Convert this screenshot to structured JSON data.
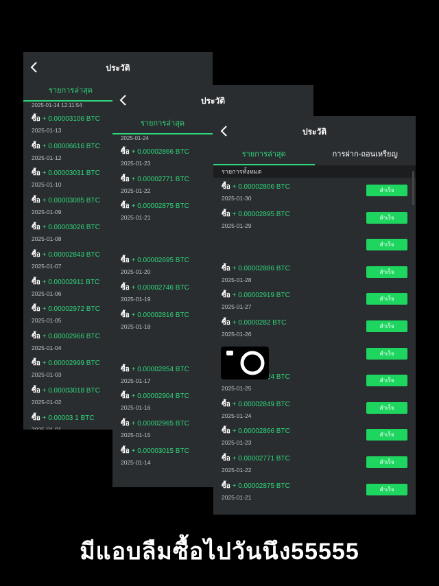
{
  "caption": "มีแอบลืมซื้อไปวันนึง55555",
  "buy_label": "ซื้อ",
  "status_label": "สำเร็จ",
  "icons": {
    "back": "chevron-left-icon",
    "camera": "camera-icon"
  },
  "colors": {
    "accent": "#2fd67a",
    "status": "#1ed65f",
    "panel": "#2a2d30"
  },
  "panel1": {
    "title": "ประวัติ",
    "tab_active": "รายการล่าสุด",
    "tab_other": "การฝาก-ถอนเหรียญ",
    "cut_top": "2025-01-14 12:11:54",
    "rows": [
      {
        "amount": "+ 0.00003106 BTC",
        "date": "2025-01-13"
      },
      {
        "amount": "+ 0.00006616 BTC",
        "date": "2025-01-12"
      },
      {
        "amount": "+ 0.00003031 BTC",
        "date": "2025-01-10"
      },
      {
        "amount": "+ 0.00003085 BTC",
        "date": "2025-01-09"
      },
      {
        "amount": "+ 0.00003026 BTC",
        "date": "2025-01-08"
      },
      {
        "amount": "+ 0.00002843 BTC",
        "date": "2025-01-07"
      },
      {
        "amount": "+ 0.00002911 BTC",
        "date": "2025-01-06"
      },
      {
        "amount": "+ 0.00002972 BTC",
        "date": "2025-01-05"
      },
      {
        "amount": "+ 0.00002966 BTC",
        "date": "2025-01-04"
      },
      {
        "amount": "+ 0.00002999 BTC",
        "date": "2025-01-03"
      },
      {
        "amount": "+ 0.00003018 BTC",
        "date": "2025-01-02"
      },
      {
        "amount": "+ 0.00003 1 BTC",
        "date": "2025-01-01"
      }
    ]
  },
  "panel2": {
    "title": "ประวัติ",
    "tab_active": "รายการล่าสุด",
    "cut_top": "2025-01-24",
    "rows": [
      {
        "amount": "+ 0.00002866 BTC",
        "date": "2025-01-23"
      },
      {
        "amount": "+ 0.00002771 BTC",
        "date": "2025-01-22"
      },
      {
        "amount": "+ 0.00002875 BTC",
        "date": "2025-01-21"
      },
      {
        "empty": true
      },
      {
        "amount": "+ 0.00002695 BTC",
        "date": "2025-01-20"
      },
      {
        "amount": "+ 0.00002746 BTC",
        "date": "2025-01-19"
      },
      {
        "amount": "+ 0.00002816 BTC",
        "date": "2025-01-18"
      },
      {
        "empty": true
      },
      {
        "amount": "+ 0.00002854 BTC",
        "date": "2025-01-17"
      },
      {
        "amount": "+ 0.00002904 BTC",
        "date": "2025-01-16"
      },
      {
        "amount": "+ 0.00002965 BTC",
        "date": "2025-01-15"
      },
      {
        "amount": "+ 0.00003015 BTC",
        "date": "2025-01-14"
      }
    ]
  },
  "panel3": {
    "title": "ประวัติ",
    "tab_active": "รายการล่าสุด",
    "tab_other": "การฝาก-ถอนเหรียญ",
    "subheader": "รายการทั้งหมด",
    "rows": [
      {
        "amount": "+ 0.00002806 BTC",
        "date": "2025-01-30"
      },
      {
        "amount": "+ 0.00002895 BTC",
        "date": "2025-01-29"
      },
      {
        "empty": true
      },
      {
        "amount": "+ 0.00002886 BTC",
        "date": "2025-01-28"
      },
      {
        "amount": "+ 0.00002919 BTC",
        "date": "2025-01-27"
      },
      {
        "amount": "+ 0.0000282 BTC",
        "date": "2025-01-26"
      },
      {
        "empty": true
      },
      {
        "amount": "+ 0.00002824 BTC",
        "date": "2025-01-25"
      },
      {
        "amount": "+ 0.00002849 BTC",
        "date": "2025-01-24"
      },
      {
        "amount": "+ 0.00002866 BTC",
        "date": "2025-01-23"
      },
      {
        "amount": "+ 0.00002771 BTC",
        "date": "2025-01-22"
      },
      {
        "amount": "+ 0.00002875 BTC",
        "date": "2025-01-21"
      }
    ]
  }
}
